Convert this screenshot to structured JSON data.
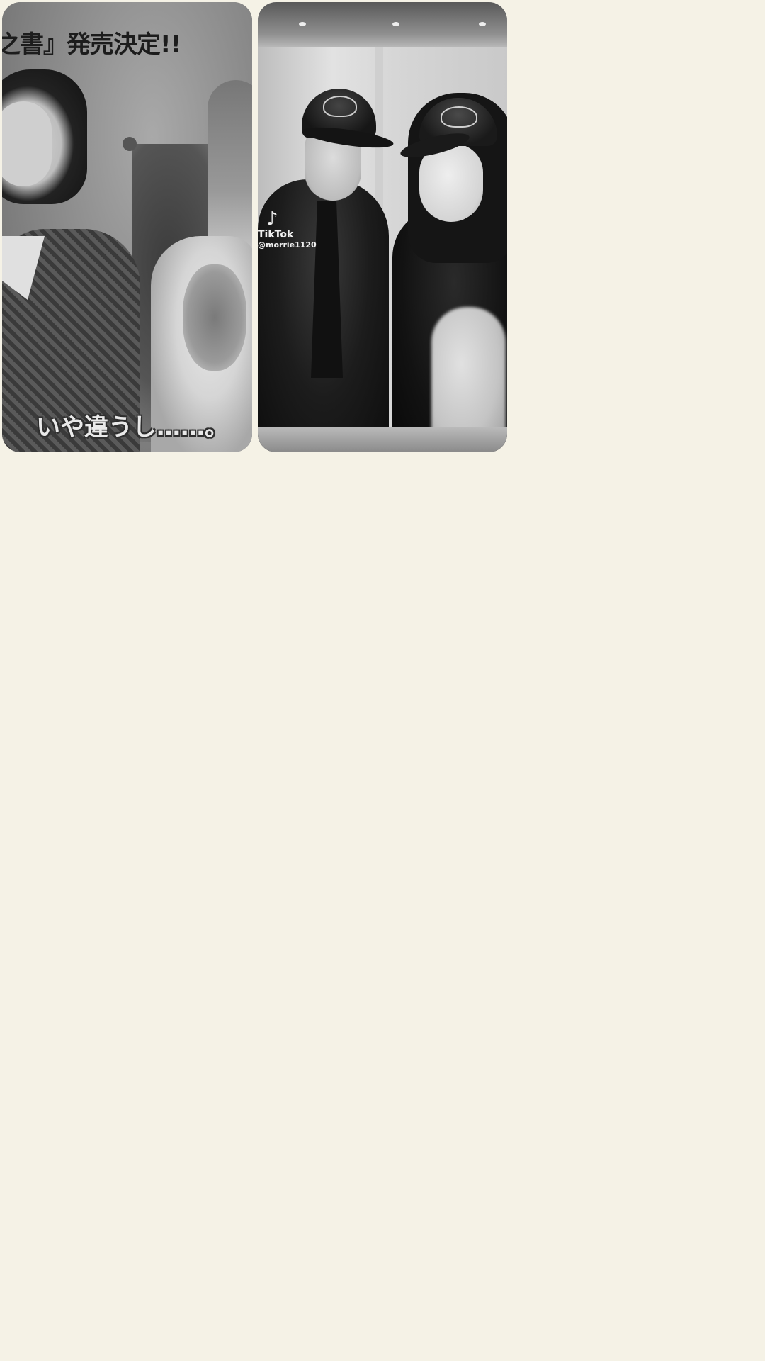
{
  "cards": [
    {
      "top_caption": "之書』発売決定!!",
      "bottom_caption": "いや違うし……。"
    },
    {
      "watermark": {
        "icon": "tiktok-icon",
        "brand": "TikTok",
        "username": "@morrie1120"
      }
    }
  ],
  "colors": {
    "page_background": "#f5f2e6"
  }
}
